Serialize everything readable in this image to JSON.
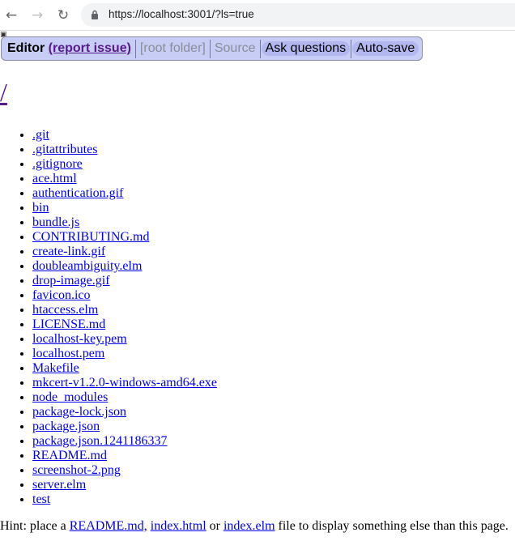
{
  "browser": {
    "url": "https://localhost:3001/?ls=true",
    "back_icon": "arrow-left",
    "forward_icon": "arrow-right",
    "reload_icon": "reload"
  },
  "menu": {
    "editor": "Editor",
    "report_issue": "(report issue)",
    "root_folder": "[root folder]",
    "source": "Source",
    "ask_questions": "Ask questions",
    "auto_save": "Auto-save",
    "accent_color": "#c8cdf5"
  },
  "page": {
    "title": "/"
  },
  "files": [
    ".git",
    ".gitattributes",
    ".gitignore",
    "ace.html",
    "authentication.gif",
    "bin",
    "bundle.js",
    "CONTRIBUTING.md",
    "create-link.gif",
    "doubleambiguity.elm",
    "drop-image.gif",
    "favicon.ico",
    "htaccess.elm",
    "LICENSE.md",
    "localhost-key.pem",
    "localhost.pem",
    "Makefile",
    "mkcert-v1.2.0-windows-amd64.exe",
    "node_modules",
    "package-lock.json",
    "package.json",
    "package.json.1241186337",
    "README.md",
    "screenshot-2.png",
    "server.elm",
    "test"
  ],
  "hint": {
    "prefix": "Hint: place a ",
    "readme": "README.md,",
    "sep1": " ",
    "index_html": "index.html",
    "or": " or ",
    "index_elm": "index.elm",
    "suffix": " file to display something else than this page."
  }
}
